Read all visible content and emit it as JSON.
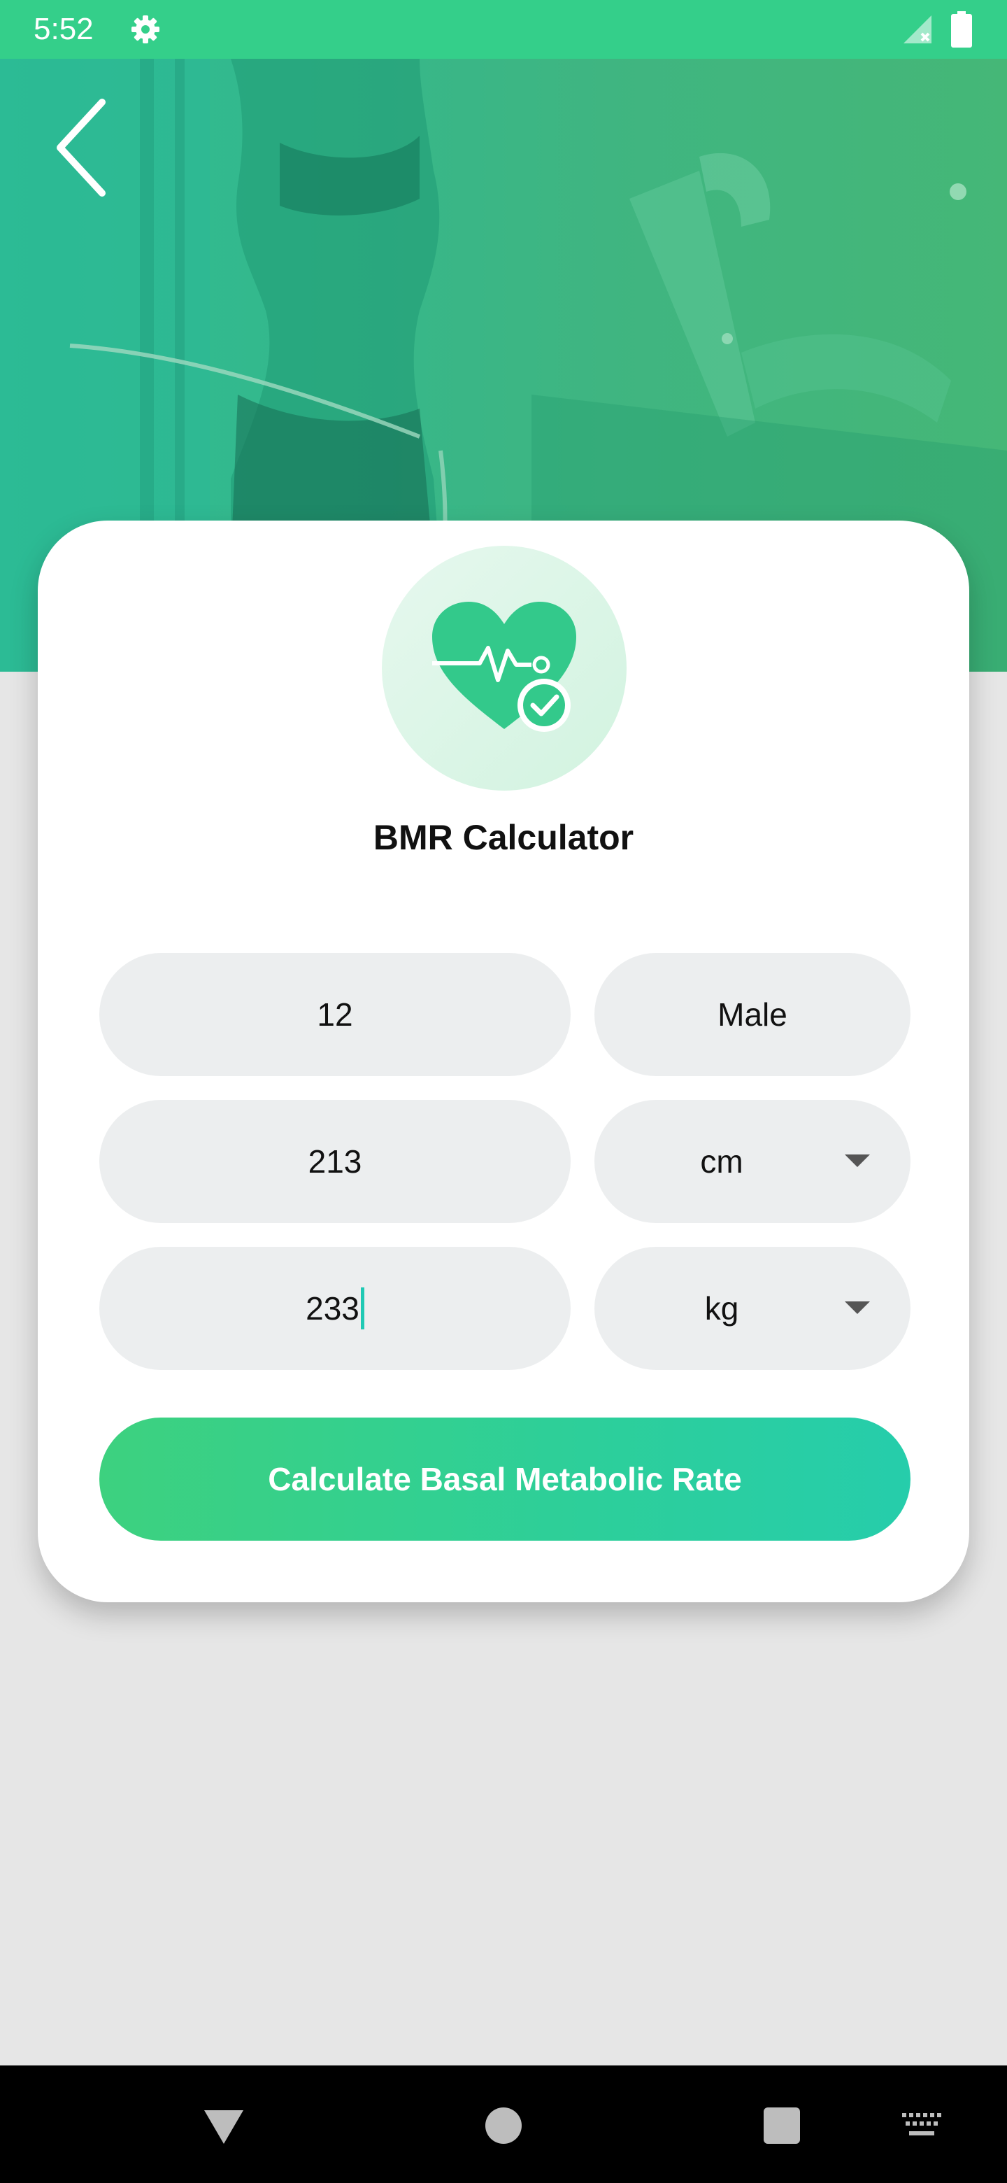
{
  "status_bar": {
    "time": "5:52",
    "icons": [
      "gear-icon",
      "signal-icon",
      "battery-icon"
    ]
  },
  "hero": {
    "back_icon": "chevron-left-icon",
    "accent_color": "#34cf8a"
  },
  "card": {
    "logo_icon": "heart-pulse-check-icon",
    "title": "BMR Calculator",
    "age": {
      "value": "12"
    },
    "gender": {
      "value": "Male"
    },
    "height": {
      "value": "213",
      "unit": "cm"
    },
    "weight": {
      "value": "233",
      "unit": "kg"
    },
    "calculate_label": "Calculate Basal Metabolic Rate"
  },
  "nav_bar": {
    "icons": [
      "nav-back-icon",
      "nav-home-icon",
      "nav-recents-icon",
      "keyboard-icon"
    ]
  }
}
